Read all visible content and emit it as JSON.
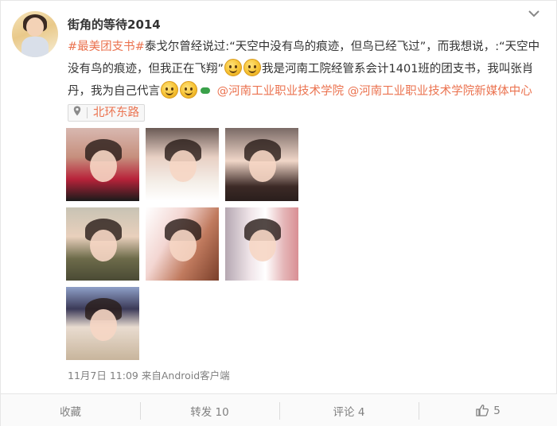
{
  "user": {
    "name": "街角的等待2014"
  },
  "post": {
    "hashtag": "#最美团支书#",
    "text1": "泰戈尔曾经说过:“天空中没有鸟的痕迹，但鸟已经飞过”，而我想说，:“天空中没有鸟的痕迹，但我正在飞翔”",
    "text2": "我是河南工院经管系会计1401班的团支书，我叫张肖丹，我为自己代言",
    "mention1": "@河南工业职业技术学院",
    "mention2": "@河南工业职业技术学院新媒体中心",
    "location": "北环东路",
    "timestamp": "11月7日 11:09",
    "source_prefix": "来自",
    "source": "Android客户端"
  },
  "photos": [
    "photo-1",
    "photo-2",
    "photo-3",
    "photo-4",
    "photo-5",
    "photo-6",
    "photo-7"
  ],
  "actions": {
    "favorite": "收藏",
    "repost": "转发 10",
    "comment": "评论 4",
    "like": "5"
  },
  "icons": {
    "menu": "chevron-down-icon",
    "location": "location-pin-icon",
    "like": "thumbs-up-icon",
    "emoji": "smiley-emoji-icon"
  },
  "colors": {
    "link": "#eb7350",
    "muted": "#808080",
    "text": "#333333"
  }
}
